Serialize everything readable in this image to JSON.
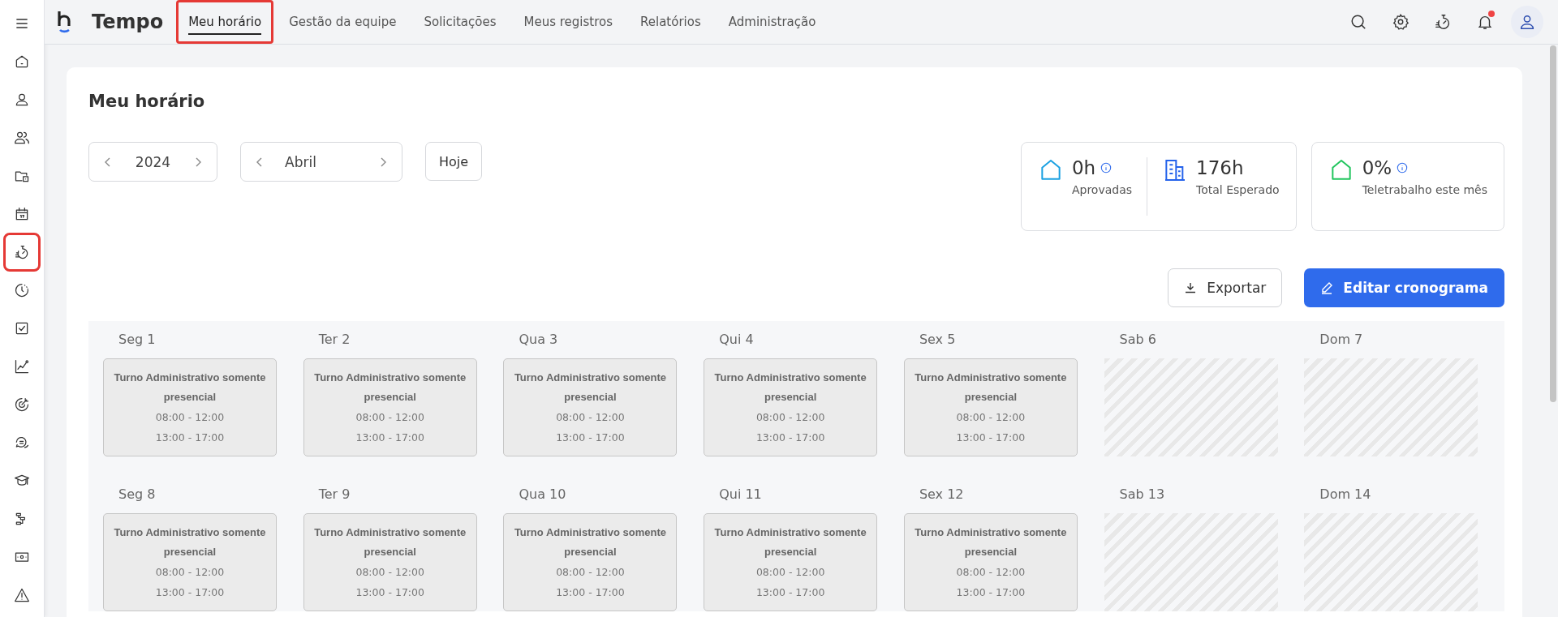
{
  "sidebar": {
    "items": [
      {
        "highlighted": false
      },
      {
        "highlighted": false
      },
      {
        "highlighted": false
      },
      {
        "highlighted": false
      },
      {
        "highlighted": false
      },
      {
        "highlighted": true
      },
      {
        "highlighted": false
      },
      {
        "highlighted": false
      },
      {
        "highlighted": false
      },
      {
        "highlighted": false
      },
      {
        "highlighted": false
      },
      {
        "highlighted": false
      },
      {
        "highlighted": false
      },
      {
        "highlighted": false
      },
      {
        "highlighted": false
      }
    ]
  },
  "header": {
    "app_name": "Tempo",
    "notification_unread": true,
    "tabs": [
      {
        "label": "Meu horário",
        "selected": true,
        "highlighted": true
      },
      {
        "label": "Gestão da equipe",
        "selected": false,
        "highlighted": false
      },
      {
        "label": "Solicitações",
        "selected": false,
        "highlighted": false
      },
      {
        "label": "Meus registros",
        "selected": false,
        "highlighted": false
      },
      {
        "label": "Relatórios",
        "selected": false,
        "highlighted": false
      },
      {
        "label": "Administração",
        "selected": false,
        "highlighted": false
      }
    ]
  },
  "page_title": "Meu horário",
  "year_picker": {
    "value": "2024"
  },
  "month_picker": {
    "value": "Abril"
  },
  "today_button": "Hoje",
  "stats": [
    {
      "value": "0h",
      "label": "Aprovadas",
      "info": true,
      "color": "#1ba1e2"
    },
    {
      "value": "176h",
      "label": "Total Esperado",
      "info": false,
      "color": "#2563eb"
    },
    {
      "value": "0%",
      "label": "Teletrabalho este mês",
      "info": true,
      "color": "#22c55e"
    }
  ],
  "export_button": "Exportar",
  "edit_button": "Editar cronograma",
  "weeks": [
    [
      {
        "day": "Seg 1",
        "kind": "shift",
        "shift": "Turno Administrativo somente presencial",
        "times": [
          "08:00 - 12:00",
          "13:00 - 17:00"
        ]
      },
      {
        "day": "Ter 2",
        "kind": "shift",
        "shift": "Turno Administrativo somente presencial",
        "times": [
          "08:00 - 12:00",
          "13:00 - 17:00"
        ]
      },
      {
        "day": "Qua 3",
        "kind": "shift",
        "shift": "Turno Administrativo somente presencial",
        "times": [
          "08:00 - 12:00",
          "13:00 - 17:00"
        ]
      },
      {
        "day": "Qui 4",
        "kind": "shift",
        "shift": "Turno Administrativo somente presencial",
        "times": [
          "08:00 - 12:00",
          "13:00 - 17:00"
        ]
      },
      {
        "day": "Sex 5",
        "kind": "shift",
        "shift": "Turno Administrativo somente presencial",
        "times": [
          "08:00 - 12:00",
          "13:00 - 17:00"
        ]
      },
      {
        "day": "Sab 6",
        "kind": "off"
      },
      {
        "day": "Dom 7",
        "kind": "off"
      }
    ],
    [
      {
        "day": "Seg 8",
        "kind": "shift",
        "shift": "Turno Administrativo somente presencial",
        "times": [
          "08:00 - 12:00",
          "13:00 - 17:00"
        ]
      },
      {
        "day": "Ter 9",
        "kind": "shift",
        "shift": "Turno Administrativo somente presencial",
        "times": [
          "08:00 - 12:00",
          "13:00 - 17:00"
        ]
      },
      {
        "day": "Qua 10",
        "kind": "shift",
        "shift": "Turno Administrativo somente presencial",
        "times": [
          "08:00 - 12:00",
          "13:00 - 17:00"
        ]
      },
      {
        "day": "Qui 11",
        "kind": "shift",
        "shift": "Turno Administrativo somente presencial",
        "times": [
          "08:00 - 12:00",
          "13:00 - 17:00"
        ]
      },
      {
        "day": "Sex 12",
        "kind": "shift",
        "shift": "Turno Administrativo somente presencial",
        "times": [
          "08:00 - 12:00",
          "13:00 - 17:00"
        ]
      },
      {
        "day": "Sab 13",
        "kind": "off"
      },
      {
        "day": "Dom 14",
        "kind": "off"
      }
    ]
  ]
}
